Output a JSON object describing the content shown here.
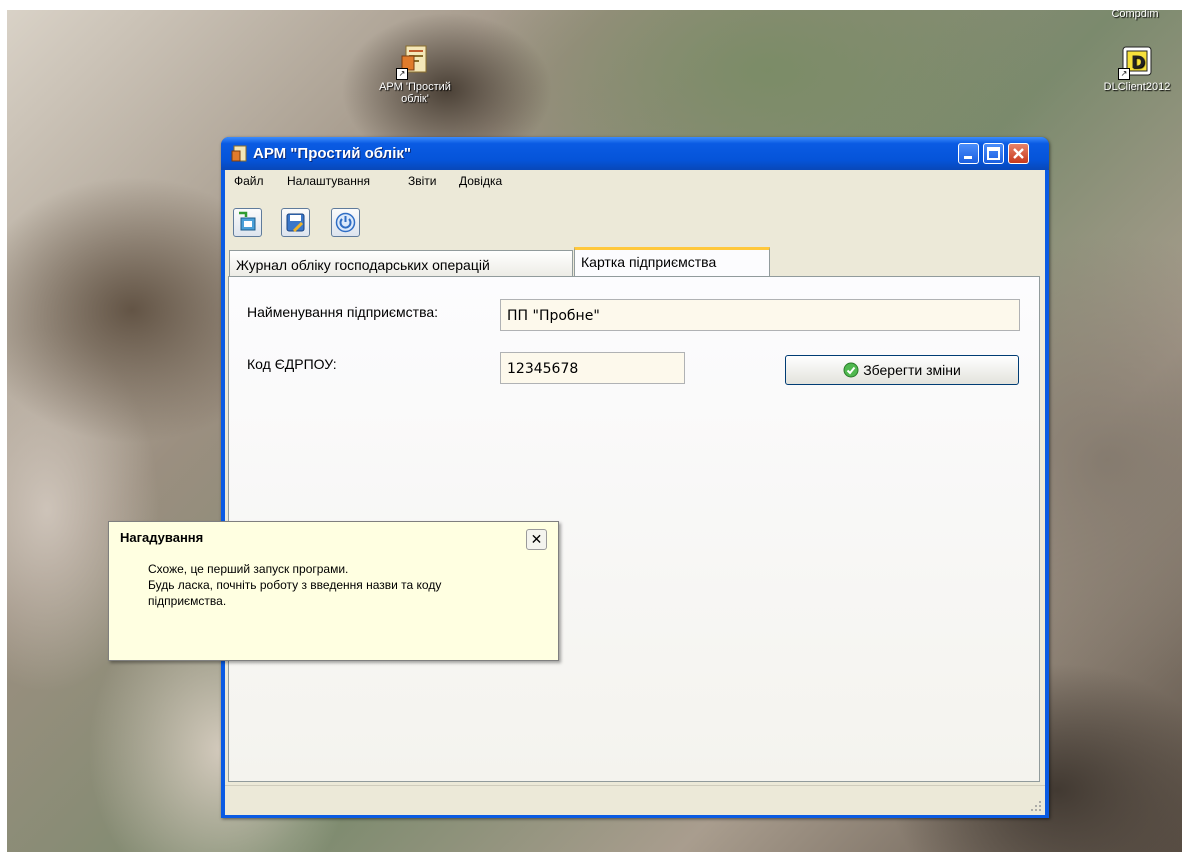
{
  "desktop": {
    "icons": [
      {
        "label_line1": "АРМ 'Простий",
        "label_line2": "облік'"
      },
      {
        "label": "Compdim"
      },
      {
        "label": "DLClient2012"
      }
    ]
  },
  "window": {
    "title": "АРМ \"Простий облік\"",
    "controls": [
      "minimize",
      "maximize",
      "close"
    ]
  },
  "menu": [
    "Файл",
    "Налаштування",
    "Звіти",
    "Довідка"
  ],
  "toolbar": {
    "icons": [
      "export-icon",
      "save-icon",
      "power-icon"
    ]
  },
  "tabs": [
    {
      "label": "Журнал обліку господарських операцій",
      "active": false
    },
    {
      "label": "Картка підприємства",
      "active": true
    }
  ],
  "form": {
    "name_label": "Найменування підприємства:",
    "name_value": "ПП \"Пробне\"",
    "code_label": "Код ЄДРПОУ:",
    "code_value": "12345678",
    "save_label": "Зберегти зміни"
  },
  "balloon": {
    "title": "Нагадування",
    "line1": "Схоже, це перший запуск програми.",
    "line2": "Будь ласка, почніть роботу з введення назви та коду",
    "line3": "підприємства."
  },
  "colors": {
    "titlebar": "#0a5be3",
    "window_bg": "#ece9d8",
    "field_bg": "#fdf9ec",
    "balloon_bg": "#ffffe1",
    "active_tab_accent": "#ffc83c"
  }
}
